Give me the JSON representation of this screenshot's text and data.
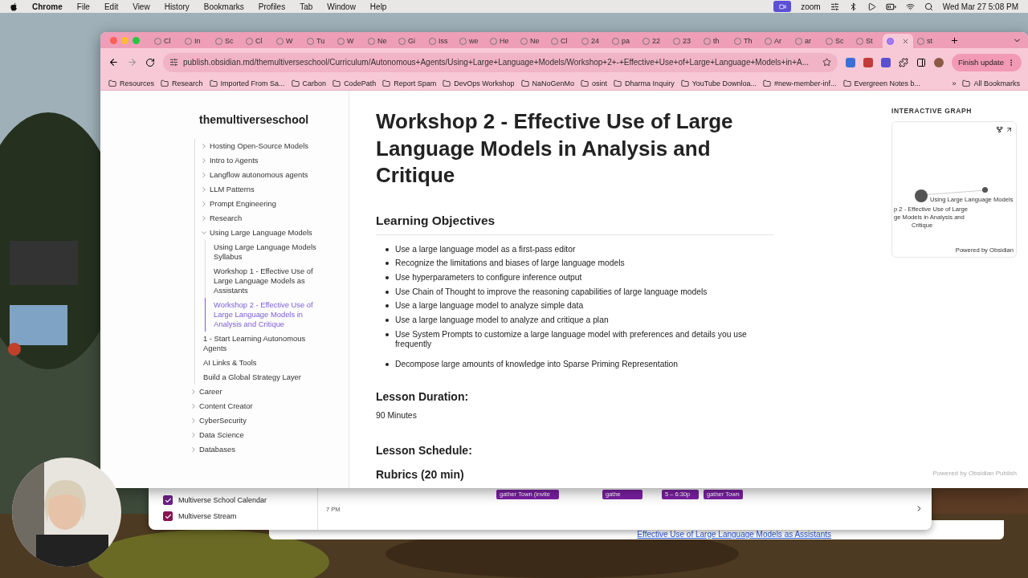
{
  "menu_bar": {
    "app": "Chrome",
    "menus": [
      "File",
      "Edit",
      "View",
      "History",
      "Bookmarks",
      "Profiles",
      "Tab",
      "Window",
      "Help"
    ],
    "zoom": "zoom",
    "clock": "Wed Mar 27  5:08 PM"
  },
  "browser": {
    "tabs": [
      {
        "label": "Cl",
        "selected": false
      },
      {
        "label": "In",
        "selected": false
      },
      {
        "label": "Sc",
        "selected": false
      },
      {
        "label": "Cl",
        "selected": false
      },
      {
        "label": "W",
        "selected": false
      },
      {
        "label": "Tu",
        "selected": false
      },
      {
        "label": "W",
        "selected": false
      },
      {
        "label": "Ne",
        "selected": false
      },
      {
        "label": "Gi",
        "selected": false
      },
      {
        "label": "Iss",
        "selected": false
      },
      {
        "label": "we",
        "selected": false
      },
      {
        "label": "He",
        "selected": false
      },
      {
        "label": "Ne",
        "selected": false
      },
      {
        "label": "Cl",
        "selected": false
      },
      {
        "label": "24",
        "selected": false
      },
      {
        "label": "pa",
        "selected": false
      },
      {
        "label": "22",
        "selected": false
      },
      {
        "label": "23",
        "selected": false
      },
      {
        "label": "th",
        "selected": false
      },
      {
        "label": "Th",
        "selected": false
      },
      {
        "label": "Ar",
        "selected": false
      },
      {
        "label": "ar",
        "selected": false
      },
      {
        "label": "Sc",
        "selected": false
      },
      {
        "label": "St",
        "selected": false
      },
      {
        "selected": true
      },
      {
        "label": "st",
        "selected": false
      }
    ],
    "address": "publish.obsidian.md/themultiverseschool/Curriculum/Autonomous+Agents/Using+Large+Language+Models/Workshop+2+-+Effective+Use+of+Large+Language+Models+in+A...",
    "update_button": "Finish update",
    "bookmarks": [
      "Resources",
      "Research",
      "Imported From Sa...",
      "Carbon",
      "CodePath",
      "Report Spam",
      "DevOps Workshop",
      "NaNoGenMo",
      "osint",
      "Dharma Inquiry",
      "YouTube Downloa...",
      "#new-member-inf...",
      "Evergreen Notes b..."
    ],
    "overflow": "»",
    "all_bookmarks": "All Bookmarks"
  },
  "sidebar": {
    "title": "themultiverseschool",
    "tree": [
      {
        "children": [
          {
            "label": "Hosting Open-Source Models",
            "kind": "folder",
            "expanded": false
          },
          {
            "label": "Intro to Agents",
            "kind": "folder",
            "expanded": false
          },
          {
            "label": "Langflow autonomous agents",
            "kind": "folder",
            "expanded": false
          },
          {
            "label": "LLM Patterns",
            "kind": "folder",
            "expanded": false
          },
          {
            "label": "Prompt Engineering",
            "kind": "folder",
            "expanded": false
          },
          {
            "label": "Research",
            "kind": "folder",
            "expanded": false
          },
          {
            "label": "Using Large Language Models",
            "kind": "folder",
            "expanded": true,
            "children": [
              {
                "label": "Using Large Language Models Syllabus",
                "kind": "file",
                "selected": false
              },
              {
                "label": "Workshop 1 - Effective Use of Large Language Models as Assistants",
                "kind": "file",
                "selected": false
              },
              {
                "label": "Workshop 2 - Effective Use of Large Language Models in Analysis and Critique",
                "kind": "file",
                "selected": true
              }
            ]
          },
          {
            "label": "1 - Start Learning Autonomous Agents",
            "kind": "file",
            "selected": false
          },
          {
            "label": "AI Links & Tools",
            "kind": "file",
            "selected": false
          },
          {
            "label": "Build a Global Strategy Layer",
            "kind": "file",
            "selected": false
          }
        ]
      },
      {
        "label": "Career",
        "kind": "folder",
        "expanded": false
      },
      {
        "label": "Content Creator",
        "kind": "folder",
        "expanded": false
      },
      {
        "label": "CyberSecurity",
        "kind": "folder",
        "expanded": false
      },
      {
        "label": "Data Science",
        "kind": "folder",
        "expanded": false
      },
      {
        "label": "Databases",
        "kind": "folder",
        "expanded": false
      }
    ]
  },
  "article": {
    "title": "Workshop 2 - Effective Use of Large Language Models in Analysis and Critique",
    "objectives_heading": "Learning Objectives",
    "objectives": [
      "Use a large language model as a first-pass editor",
      "Recognize the limitations and biases of large language models",
      "Use hyperparameters to configure inference output",
      "Use Chain of Thought to improve the reasoning capabilities of large language models",
      "Use a large language model to analyze simple data",
      "Use a large language model to analyze and critique a plan",
      "Use System Prompts to customize a large language model with preferences and details you use frequently"
    ],
    "objectives_more": [
      "Decompose large amounts of knowledge into Sparse Priming Representation"
    ],
    "duration_heading": "Lesson Duration:",
    "duration": "90 Minutes",
    "schedule_heading": "Lesson Schedule:",
    "rubrics_heading": "Rubrics (20 min)"
  },
  "graph": {
    "heading": "INTERACTIVE GRAPH",
    "current_node_lines": [
      "p 2 - Effective Use of Large",
      "ge Models in Analysis and",
      "Critique"
    ],
    "linked_node": "Using Large Language Models",
    "credit": "Powered by Obsidian"
  },
  "footer": "Powered by Obsidian Publish",
  "calendar": {
    "calendars": [
      {
        "label": "Multiverse School Calendar",
        "checked": true,
        "color": "#6b1f8a"
      },
      {
        "label": "Multiverse Stream",
        "checked": true,
        "color": "#8a1550"
      }
    ],
    "time": "7 PM",
    "events": [
      "gather Town (invite",
      "gathe",
      "5 – 6:30p",
      "gather Town"
    ]
  },
  "back_window_link": "Effective Use of Large Language Models as Assistants"
}
